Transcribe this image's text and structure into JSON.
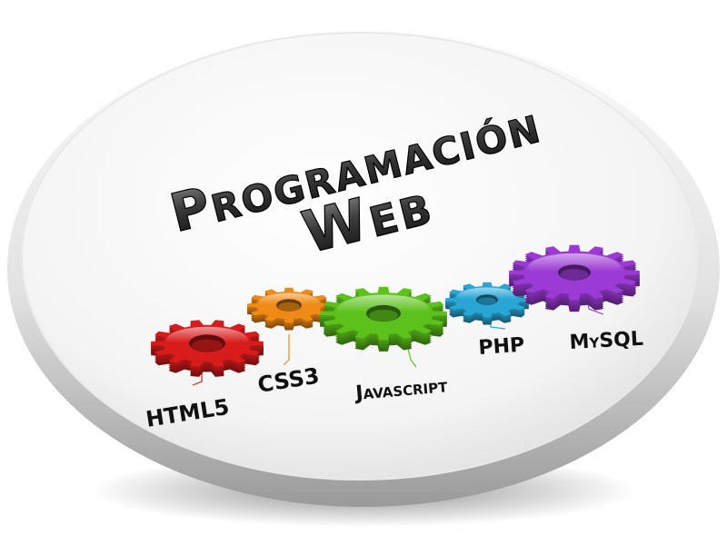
{
  "title": {
    "line1": "Programación",
    "line2": "Web"
  },
  "technologies": [
    {
      "label": "HTML5",
      "color": "#d81c1c",
      "icon": "red-gear"
    },
    {
      "label": "CSS3",
      "color": "#f08a16",
      "icon": "orange-gear"
    },
    {
      "label": "Javascript",
      "color": "#5cc21b",
      "icon": "green-gear"
    },
    {
      "label": "PHP",
      "color": "#2aa6d6",
      "icon": "blue-gear"
    },
    {
      "label": "MySQL",
      "color": "#9b3ad4",
      "icon": "purple-gear"
    }
  ]
}
